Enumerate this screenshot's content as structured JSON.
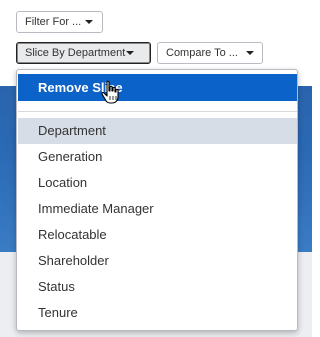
{
  "toolbar": {
    "filter_label": "Filter For ...",
    "slice_label": "Slice By Department",
    "compare_label": "Compare To ..."
  },
  "menu": {
    "remove_label": "Remove Slice",
    "items": [
      {
        "label": "Department",
        "highlighted": true
      },
      {
        "label": "Generation"
      },
      {
        "label": "Location"
      },
      {
        "label": "Immediate Manager"
      },
      {
        "label": "Relocatable"
      },
      {
        "label": "Shareholder"
      },
      {
        "label": "Status"
      },
      {
        "label": "Tenure"
      }
    ]
  },
  "colors": {
    "accent": "#0b62c8",
    "highlight": "#d7dde6"
  },
  "icons": {
    "cursor": "hand-pointer-icon",
    "caret": "caret-down-icon"
  }
}
